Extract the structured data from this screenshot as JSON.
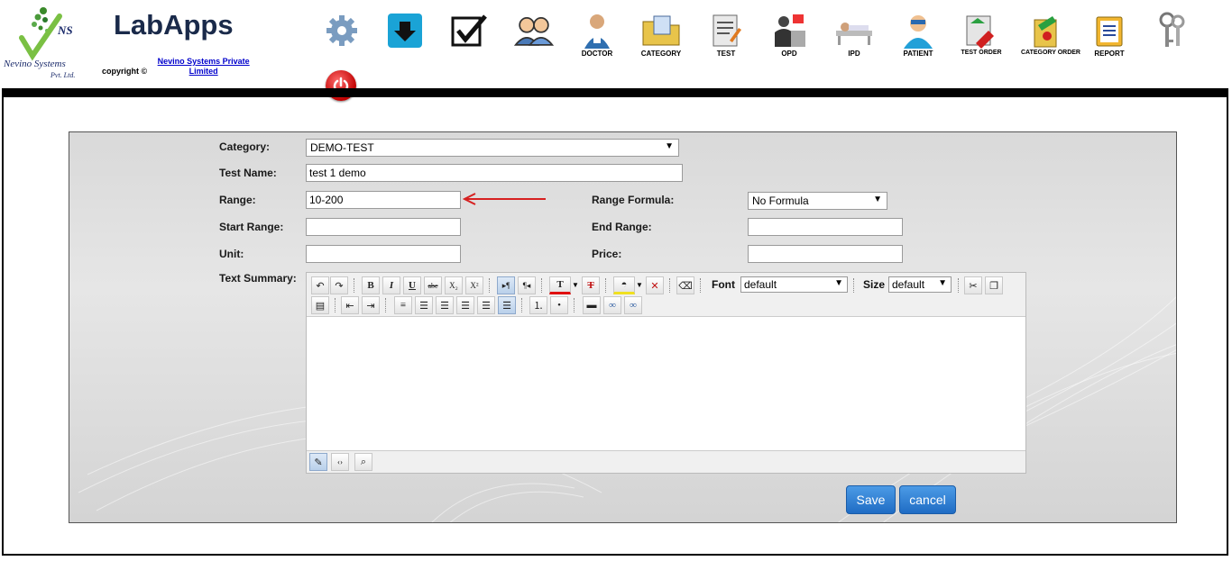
{
  "header": {
    "brand": "LabApps",
    "copyright_prefix": "copyright ©",
    "copyright_link": "Nevino Systems Private Limited",
    "logo_text_top": "NS",
    "logo_text_main": "Nevino Systems",
    "logo_text_sub": "Pvt. Ltd.",
    "nav": [
      {
        "label": "",
        "icon": "gear-icon"
      },
      {
        "label": "",
        "icon": "download-icon"
      },
      {
        "label": "",
        "icon": "checkbox-icon"
      },
      {
        "label": "",
        "icon": "users-icon"
      },
      {
        "label": "DOCTOR",
        "icon": "doctor-icon"
      },
      {
        "label": "CATEGORY",
        "icon": "category-folder-icon"
      },
      {
        "label": "TEST",
        "icon": "test-icon"
      },
      {
        "label": "OPD",
        "icon": "opd-icon"
      },
      {
        "label": "IPD",
        "icon": "ipd-icon"
      },
      {
        "label": "PATIENT",
        "icon": "patient-icon"
      },
      {
        "label": "TEST ORDER",
        "icon": "test-order-icon"
      },
      {
        "label": "CATEGORY ORDER",
        "icon": "category-order-icon"
      },
      {
        "label": "REPORT",
        "icon": "report-icon"
      },
      {
        "label": "",
        "icon": "keys-icon"
      }
    ]
  },
  "form": {
    "category_label": "Category:",
    "category_value": "DEMO-TEST",
    "test_name_label": "Test Name:",
    "test_name_value": "test 1 demo",
    "range_label": "Range:",
    "range_value": "10-200",
    "range_formula_label": "Range Formula:",
    "range_formula_value": "No Formula",
    "start_range_label": "Start Range:",
    "start_range_value": "",
    "end_range_label": "End Range:",
    "end_range_value": "",
    "unit_label": "Unit:",
    "unit_value": "",
    "price_label": "Price:",
    "price_value": "",
    "text_summary_label": "Text Summary:"
  },
  "editor": {
    "font_label": "Font",
    "font_value": "default",
    "size_label": "Size",
    "size_value": "default",
    "bold": "B",
    "italic": "I",
    "underline": "U",
    "strike": "abc",
    "subscript": "X₂",
    "superscript": "X²",
    "text_color": "T"
  },
  "actions": {
    "save": "Save",
    "cancel": "cancel"
  },
  "colors": {
    "accent": "#1f6cc4",
    "arrow": "#d62020",
    "brand": "#1a2a4a"
  }
}
